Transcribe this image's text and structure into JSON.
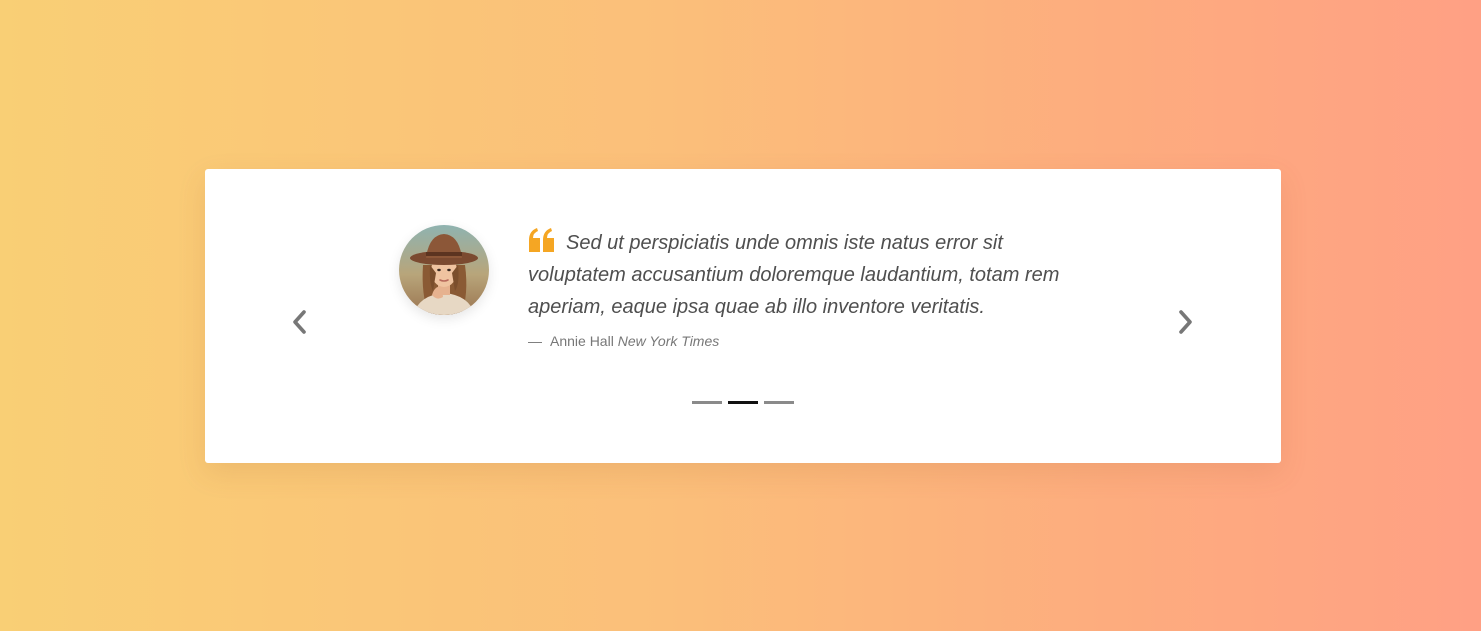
{
  "testimonial": {
    "quote": "Sed ut perspiciatis unde omnis iste natus error sit voluptatem accusantium doloremque laudantium, totam rem aperiam, eaque ipsa quae ab illo inventore veritatis.",
    "dash": "—",
    "author": "Annie Hall",
    "source": "New York Times",
    "avatar_icon": "woman-with-hat-photo",
    "quote_icon": "quote-icon"
  },
  "carousel": {
    "prev_icon": "chevron-left-icon",
    "next_icon": "chevron-right-icon",
    "slide_count": 3,
    "active_index": 1
  },
  "colors": {
    "accent": "#f5a623",
    "arrow": "#777777",
    "indicator": "#8a8a8a",
    "indicator_active": "#111111"
  }
}
